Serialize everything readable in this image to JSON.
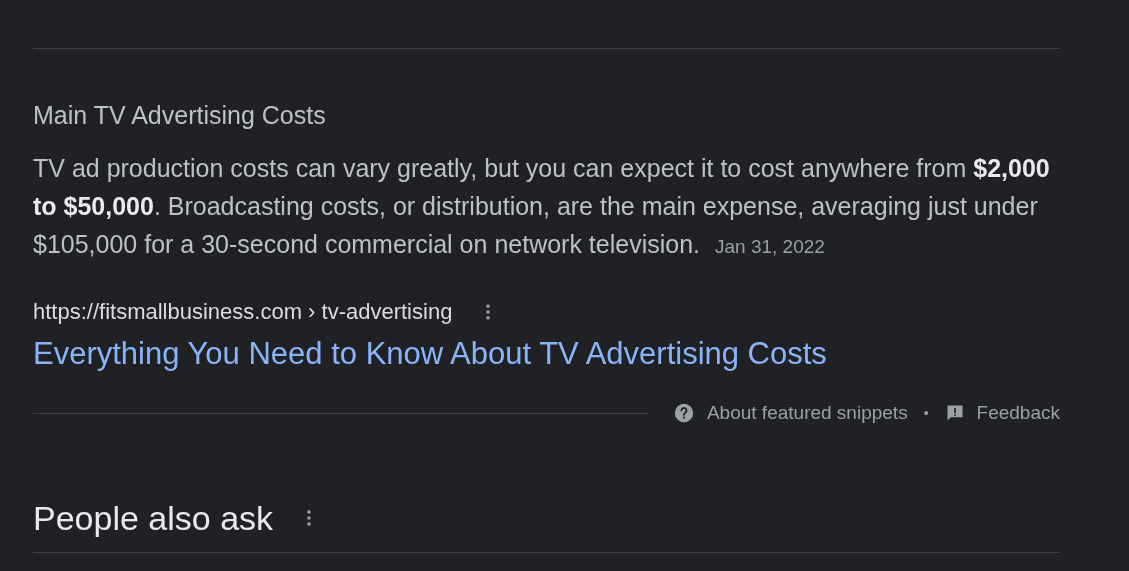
{
  "snippet": {
    "heading": "Main TV Advertising Costs",
    "text": "TV ad production costs can vary greatly, but you can expect it to cost anywhere from **$2,000 to $50,000**. Broadcasting costs, or distribution, are the main expense, averaging just under $105,000 for a 30-second commercial on network television.",
    "date": "Jan 31, 2022",
    "source_url": "https://fitsmallbusiness.com › tv-advertising",
    "link_title": "Everything You Need to Know About TV Advertising Costs"
  },
  "footer_links": [
    {
      "kind": "help",
      "label": "About featured snippets"
    },
    {
      "kind": "feedback",
      "label": "Feedback"
    }
  ],
  "separator": "•",
  "people_also_ask": {
    "title": "People also ask"
  }
}
